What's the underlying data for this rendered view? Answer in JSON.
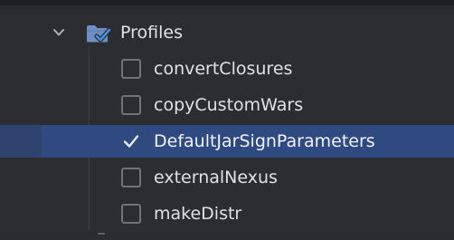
{
  "tree": {
    "group": {
      "label": "Profiles",
      "expanded": true,
      "icon": "folder-check-icon",
      "chevron_icon": "chevron-down-icon"
    },
    "items": [
      {
        "label": "convertClosures",
        "checked": false,
        "selected": false
      },
      {
        "label": "copyCustomWars",
        "checked": false,
        "selected": false
      },
      {
        "label": "DefaultJarSignParameters",
        "checked": true,
        "selected": true
      },
      {
        "label": "externalNexus",
        "checked": false,
        "selected": false
      },
      {
        "label": "makeDistr",
        "checked": false,
        "selected": false
      }
    ]
  },
  "colors": {
    "background": "#2b2d30",
    "selection": "#2f4a80",
    "folder": "#6e8fc4",
    "checkmark": "#4a8fe0"
  }
}
